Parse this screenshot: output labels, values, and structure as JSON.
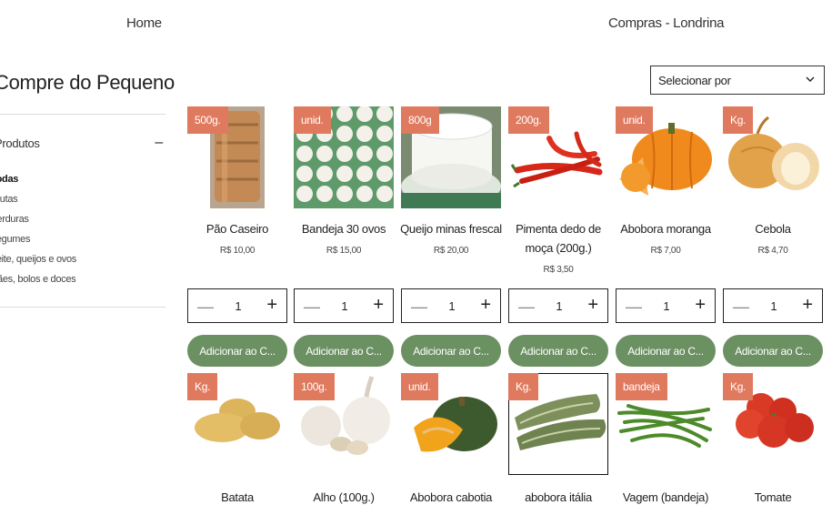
{
  "nav": {
    "home": "Home",
    "location": "Compras - Londrina"
  },
  "sidebar": {
    "brand": "Compre do Pequeno",
    "category_header": "Produtos",
    "collapse_icon": "minus-icon",
    "items": [
      {
        "label": "Todas",
        "active": true
      },
      {
        "label": "Frutas"
      },
      {
        "label": "Verduras"
      },
      {
        "label": "Legumes"
      },
      {
        "label": "Leite, queijos e ovos"
      },
      {
        "label": "Pães, bolos e doces"
      }
    ]
  },
  "sort": {
    "label": "Selecionar por",
    "icon": "chevron-down-icon"
  },
  "colors": {
    "badge": "#e07a5f",
    "button": "#6b9062"
  },
  "products": [
    {
      "badge": "500g.",
      "name": "Pão Caseiro",
      "price": "R$ 10,00",
      "qty": "1",
      "add": "Adicionar ao C..."
    },
    {
      "badge": "unid.",
      "name": "Bandeja 30 ovos",
      "price": "R$ 15,00",
      "qty": "1",
      "add": "Adicionar ao C..."
    },
    {
      "badge": "800g",
      "name": "Queijo minas frescal",
      "price": "R$ 20,00",
      "qty": "1",
      "add": "Adicionar ao C..."
    },
    {
      "badge": "200g.",
      "name": "Pimenta dedo de moça (200g.)",
      "price": "R$ 3,50",
      "qty": "1",
      "add": "Adicionar ao C..."
    },
    {
      "badge": "unid.",
      "name": "Abobora moranga",
      "price": "R$ 7,00",
      "qty": "1",
      "add": "Adicionar ao C..."
    },
    {
      "badge": "Kg.",
      "name": "Cebola",
      "price": "R$ 4,70",
      "qty": "1",
      "add": "Adicionar ao C..."
    },
    {
      "badge": "Kg.",
      "name": "Batata"
    },
    {
      "badge": "100g.",
      "name": "Alho (100g.)"
    },
    {
      "badge": "unid.",
      "name": "Abobora cabotia"
    },
    {
      "badge": "Kg.",
      "name": "abobora itália"
    },
    {
      "badge": "bandeja",
      "name": "Vagem (bandeja)"
    },
    {
      "badge": "Kg.",
      "name": "Tomate"
    }
  ]
}
